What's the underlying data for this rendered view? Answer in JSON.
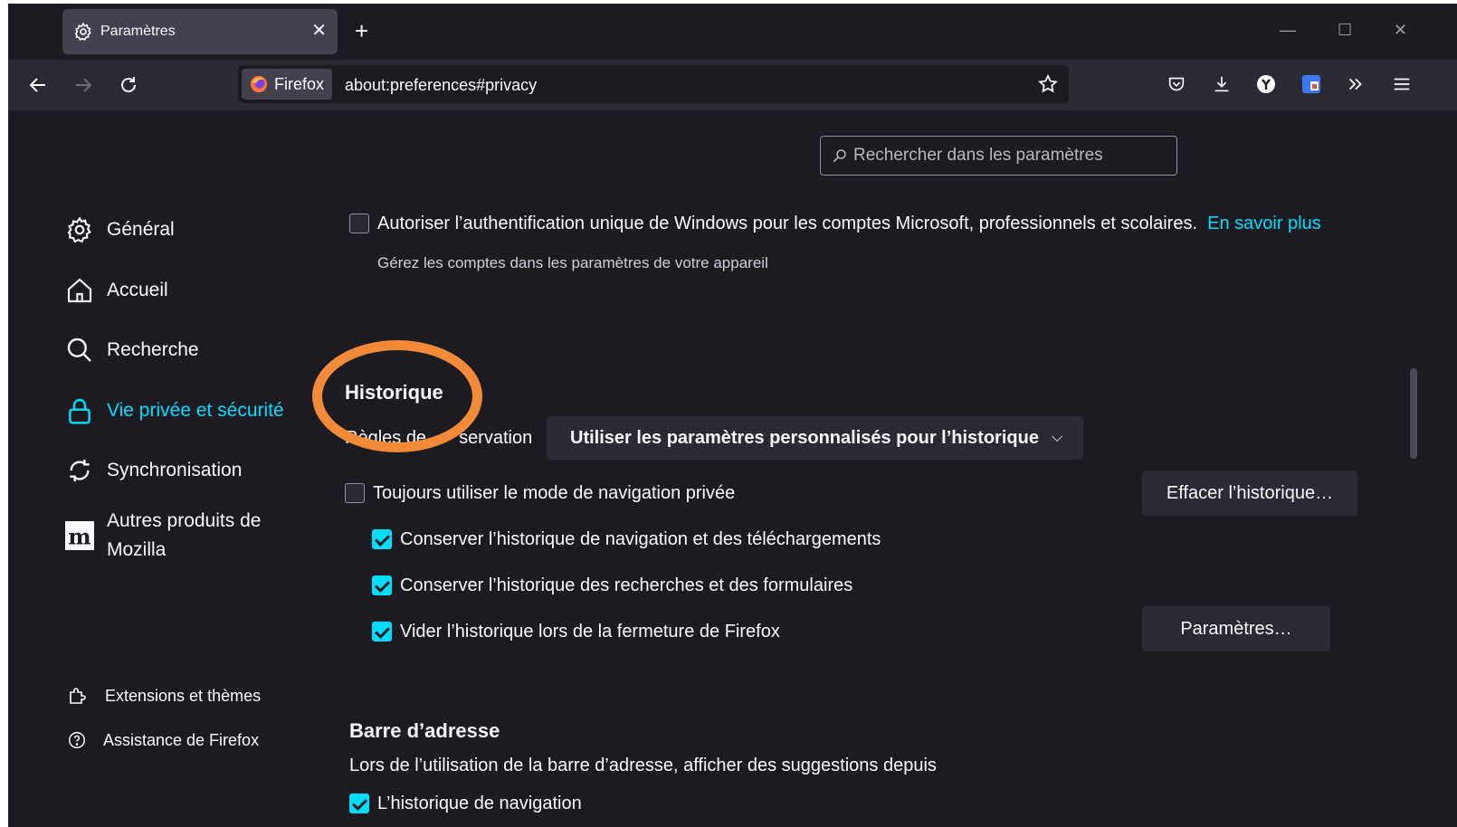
{
  "window": {
    "tab_title": "Paramètres",
    "tab_close": "✕",
    "new_tab": "+",
    "controls": {
      "minimize": "—",
      "maximize": "☐",
      "close": "✕"
    }
  },
  "navbar": {
    "identity_label": "Firefox",
    "url": "about:preferences#privacy",
    "icons": [
      "back-icon",
      "forward-icon",
      "reload-icon",
      "bookmark-star-icon",
      "pocket-icon",
      "download-icon",
      "extension-y-icon",
      "extension-blue-icon",
      "overflow-icon",
      "menu-icon"
    ]
  },
  "search": {
    "placeholder": "Rechercher dans les paramètres"
  },
  "sidebar": {
    "items": [
      {
        "label": "Général",
        "icon": "gear-icon"
      },
      {
        "label": "Accueil",
        "icon": "home-icon"
      },
      {
        "label": "Recherche",
        "icon": "search-icon"
      },
      {
        "label": "Vie privée et sécurité",
        "icon": "lock-icon",
        "active": true
      },
      {
        "label": "Synchronisation",
        "icon": "sync-icon"
      },
      {
        "label_line1": "Autres produits de",
        "label_line2": "Mozilla",
        "icon": "mozilla-icon"
      }
    ],
    "footer": [
      {
        "label": "Extensions et thèmes",
        "icon": "puzzle-icon"
      },
      {
        "label": "Assistance de Firefox",
        "icon": "help-icon"
      }
    ]
  },
  "windows_sso": {
    "label": "Autoriser l’authentification unique de Windows pour les comptes Microsoft, professionnels et scolaires.",
    "link": "En savoir plus",
    "hint": "Gérez les comptes dans les paramètres de votre appareil",
    "checked": false
  },
  "history": {
    "heading": "Historique",
    "retention_label_visible_start": "Règles de",
    "retention_label_visible_end": "servation",
    "retention_select": "Utiliser les paramètres personnalisés pour l’historique",
    "always_private": {
      "label": "Toujours utiliser le mode de navigation privée",
      "checked": false
    },
    "clear_button": "Effacer l’historique…",
    "options": [
      {
        "label": "Conserver l’historique de navigation et des téléchargements",
        "checked": true
      },
      {
        "label": "Conserver l’historique des recherches et des formulaires",
        "checked": true
      },
      {
        "label": "Vider l’historique lors de la fermeture de Firefox",
        "checked": true
      }
    ],
    "settings_button": "Paramètres…"
  },
  "address_bar": {
    "heading": "Barre d’adresse",
    "description": "Lors de l’utilisation de la barre d’adresse, afficher des suggestions depuis",
    "first_option": {
      "label": "L’historique de navigation",
      "checked": true
    }
  },
  "colors": {
    "accent": "#00ddff",
    "annotation": "#f38a38",
    "background": "#1c1b22"
  }
}
